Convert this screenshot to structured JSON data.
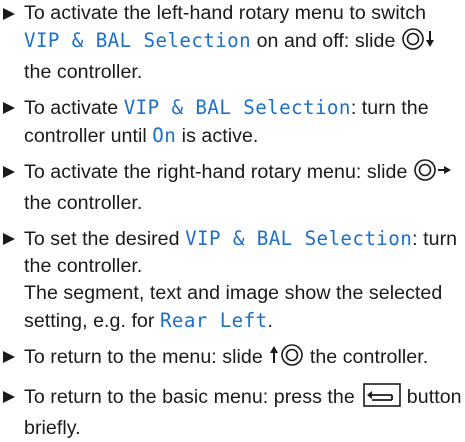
{
  "steps": [
    {
      "pre": "To activate the left-hand rotary menu to switch ",
      "kw": "VIP & BAL Selection",
      "mid": " on and off: slide ",
      "icon": "controller-slide-down-icon",
      "post": " the controller."
    },
    {
      "pre": "To activate ",
      "kw": "VIP & BAL Selection",
      "mid": ": turn the controller until ",
      "kw2": "On",
      "post": " is active."
    },
    {
      "pre": "To activate the right-hand rotary menu: slide ",
      "icon": "controller-slide-right-icon",
      "post": " the controller."
    },
    {
      "pre": "To set the desired ",
      "kw": "VIP & BAL Selection",
      "mid": ": turn the controller.",
      "cont": "The segment, text and image show the selected setting, e.g. for ",
      "kw2": "Rear Left",
      "post": "."
    },
    {
      "pre": "To return to the menu: slide ",
      "icon": "controller-slide-up-icon",
      "post": " the controller."
    },
    {
      "pre": "To return to the basic menu: press the ",
      "icon": "back-button-icon",
      "post": " button briefly."
    }
  ],
  "colors": {
    "text": "#1a1a1a",
    "keyword": "#1d6fc8"
  }
}
